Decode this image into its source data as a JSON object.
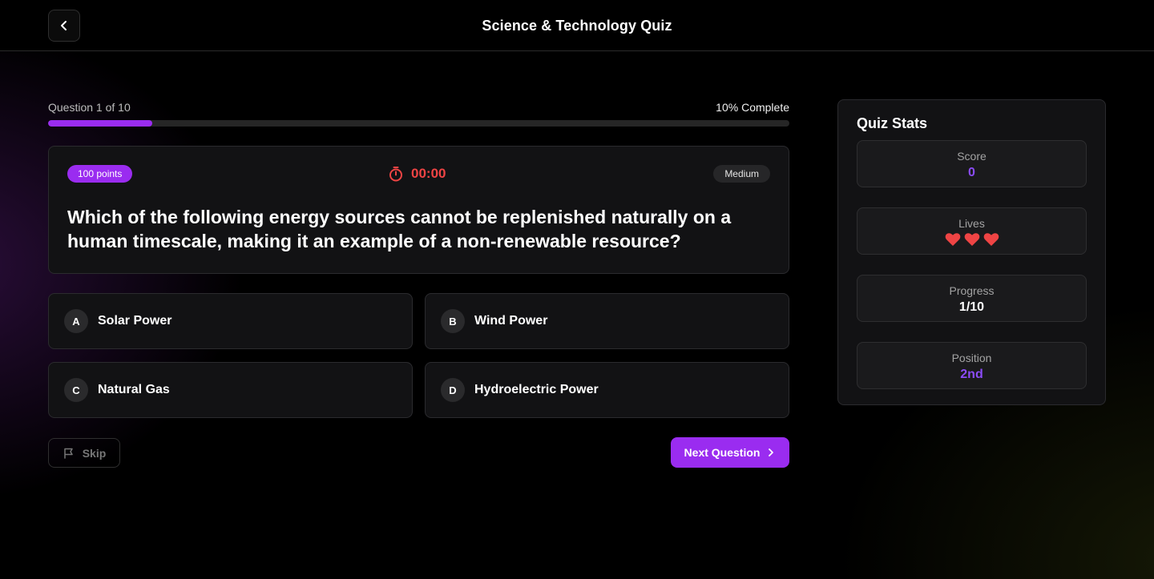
{
  "header": {
    "title": "Science & Technology Quiz",
    "back_icon": "chevron-left-icon"
  },
  "progress": {
    "question_label": "Question 1 of 10",
    "complete_label": "10% Complete",
    "fraction": 0.14,
    "fill_color": "#9a2cf0"
  },
  "question": {
    "points": "100 points",
    "timer": "00:00",
    "timer_icon": "stopwatch-icon",
    "difficulty": "Medium",
    "text": "Which of the following energy sources cannot be replenished naturally on a human timescale, making it an example of a non-renewable resource?"
  },
  "answers": [
    {
      "letter": "A",
      "label": "Solar Power"
    },
    {
      "letter": "B",
      "label": "Wind Power"
    },
    {
      "letter": "C",
      "label": "Natural Gas"
    },
    {
      "letter": "D",
      "label": "Hydroelectric Power"
    }
  ],
  "actions": {
    "skip_label": "Skip",
    "skip_icon": "flag-icon",
    "next_label": "Next Question",
    "next_icon": "chevron-right-icon"
  },
  "stats": {
    "title": "Quiz Stats",
    "score_label": "Score",
    "score_value": "0",
    "lives_label": "Lives",
    "lives_count": 3,
    "lives_icon": "heart-icon",
    "progress_label": "Progress",
    "progress_value": "1/10",
    "position_label": "Position",
    "position_value": "2nd"
  },
  "colors": {
    "accent": "#9a2cf0",
    "timer": "#ef4444",
    "heart": "#ef4444",
    "stat_highlight": "#8b4cf7"
  }
}
